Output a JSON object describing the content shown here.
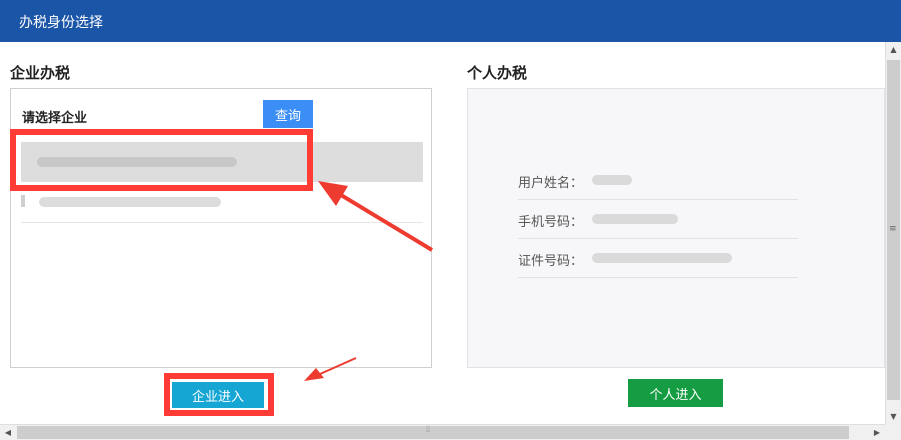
{
  "window": {
    "title": "办税身份选择"
  },
  "corporate": {
    "heading": "企业办税",
    "select_label": "请选择企业",
    "query_button": "查询",
    "enter_button": "企业进入"
  },
  "personal": {
    "heading": "个人办税",
    "labels": {
      "name": "用户姓名：",
      "phone": "手机号码：",
      "id": "证件号码："
    },
    "enter_button": "个人进入"
  },
  "colors": {
    "titlebar": "#1b55a7",
    "query_button": "#3a8ef6",
    "corp_enter": "#15a6d4",
    "personal_enter": "#169c43",
    "highlight": "#ff3b35"
  }
}
